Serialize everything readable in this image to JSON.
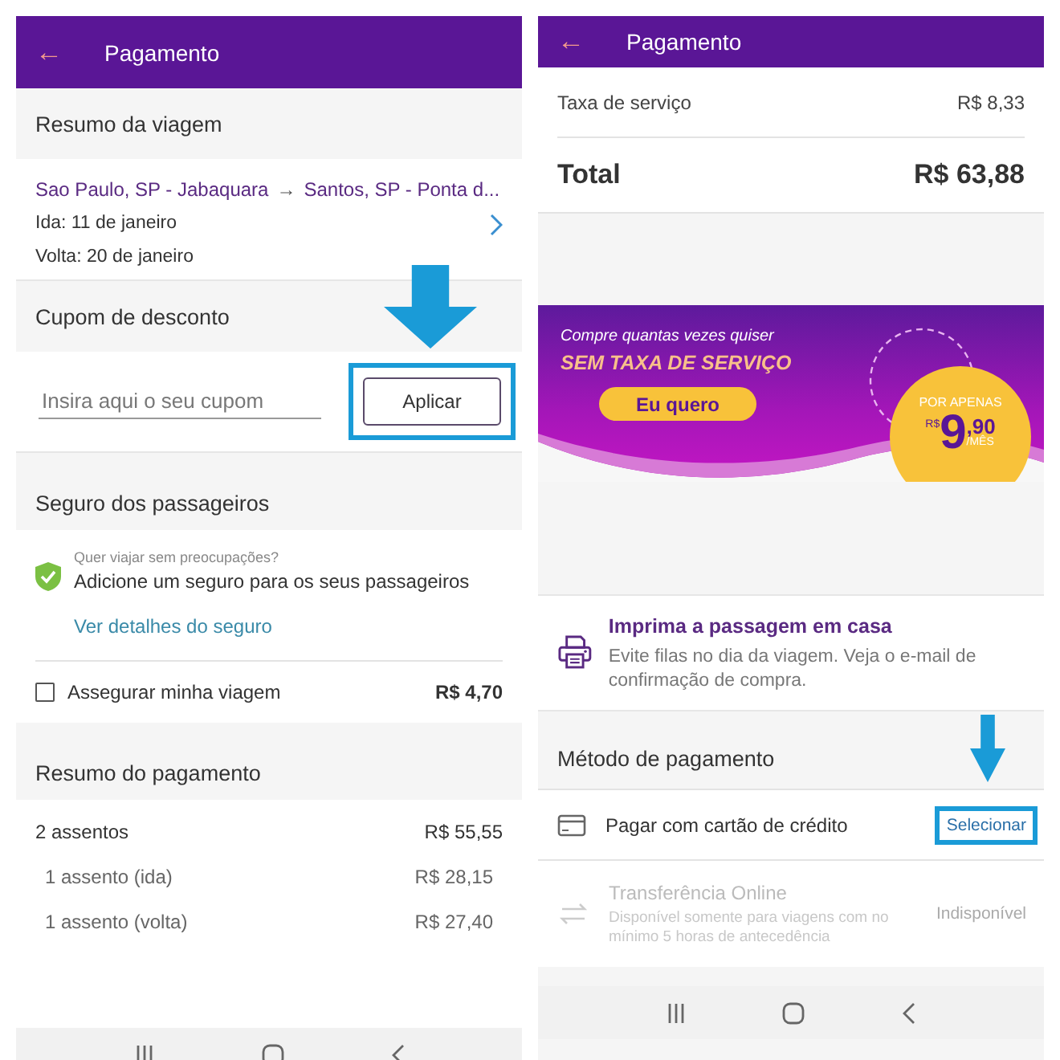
{
  "left_screen": {
    "header": {
      "back": "←",
      "title": "Pagamento"
    },
    "trip": {
      "heading": "Resumo da viagem",
      "route_from": "Sao Paulo, SP - Jabaquara",
      "route_arrow": "→",
      "route_to": "Santos, SP - Ponta d...",
      "outbound": "Ida: 11 de janeiro",
      "return": "Volta: 20 de janeiro"
    },
    "coupon": {
      "heading": "Cupom de desconto",
      "placeholder": "Insira aqui o seu cupom",
      "button": "Aplicar",
      "highlighted": true
    },
    "insurance": {
      "heading": "Seguro dos passageiros",
      "question": "Quer viajar sem preocupações?",
      "offer": "Adicione um seguro para os seus passageiros",
      "link": "Ver detalhes do seguro",
      "checkbox_label": "Assegurar minha viagem",
      "checked": false,
      "price": "R$ 4,70"
    },
    "payment_summary": {
      "heading": "Resumo do pagamento",
      "rows": [
        {
          "label": "2 assentos",
          "value": "R$ 55,55",
          "kind": "main"
        },
        {
          "label": "1 assento (ida)",
          "value": "R$ 28,15",
          "kind": "sub"
        },
        {
          "label": "1 assento (volta)",
          "value": "R$ 27,40",
          "kind": "sub"
        }
      ]
    }
  },
  "right_screen": {
    "header": {
      "back": "←",
      "title": "Pagamento"
    },
    "fee": {
      "label": "Taxa de serviço",
      "value": "R$ 8,33"
    },
    "total": {
      "label": "Total",
      "value": "R$ 63,88"
    },
    "promo": {
      "tagline": "Compre quantas vezes quiser",
      "headline": "SEM TAXA DE SERVIÇO",
      "button": "Eu quero",
      "badge_top": "POR APENAS",
      "currency": "R$",
      "amount": "9",
      "cents": ",90",
      "period": "/MÊS"
    },
    "print": {
      "title": "Imprima a passagem em casa",
      "text": "Evite filas no dia da viagem. Veja o e-mail de confirmação de compra."
    },
    "payment_methods": {
      "heading": "Método de pagamento",
      "items": [
        {
          "kind": "card",
          "label": "Pagar com cartão de crédito",
          "action": "Selecionar",
          "disabled": false,
          "highlighted": true
        },
        {
          "kind": "transfer",
          "label": "Transferência Online",
          "note": "Disponível somente para viagens com no mínimo 5 horas de antecedência",
          "action": "Indisponível",
          "disabled": true,
          "highlighted": false
        }
      ]
    }
  }
}
